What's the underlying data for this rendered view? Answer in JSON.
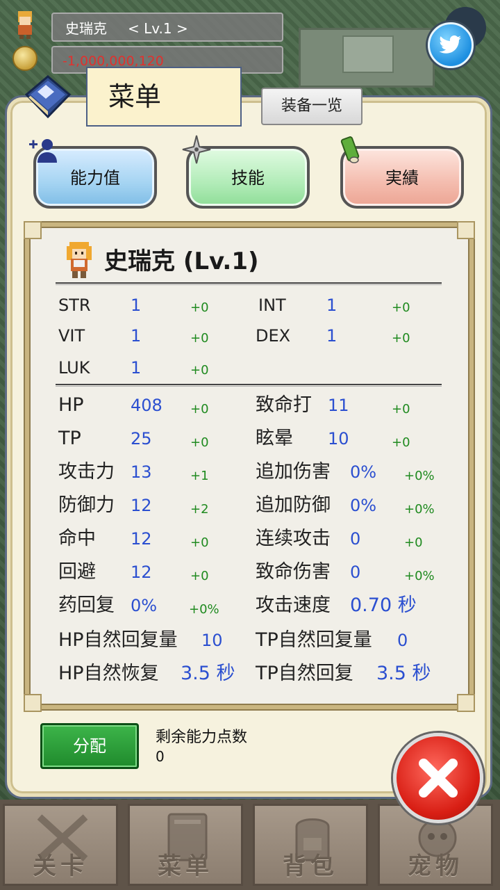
{
  "hud": {
    "name": "史瑞克",
    "level": "< Lv.1 >",
    "money": "-1,000,000,120"
  },
  "menu": {
    "title": "菜单",
    "equip_button": "装备一览",
    "tabs": [
      "能力值",
      "技能",
      "実績"
    ]
  },
  "character": {
    "title": "史瑞克 (Lv.1)"
  },
  "base_stats": [
    {
      "label": "STR",
      "value": "1",
      "bonus": "+0"
    },
    {
      "label": "INT",
      "value": "1",
      "bonus": "+0"
    },
    {
      "label": "VIT",
      "value": "1",
      "bonus": "+0"
    },
    {
      "label": "DEX",
      "value": "1",
      "bonus": "+0"
    },
    {
      "label": "LUK",
      "value": "1",
      "bonus": "+0"
    }
  ],
  "combat_stats_left": [
    {
      "label": "HP",
      "value": "408",
      "bonus": "+0"
    },
    {
      "label": "TP",
      "value": "25",
      "bonus": "+0"
    },
    {
      "label": "攻击力",
      "value": "13",
      "bonus": "+1"
    },
    {
      "label": "防御力",
      "value": "12",
      "bonus": "+2"
    },
    {
      "label": "命中",
      "value": "12",
      "bonus": "+0"
    },
    {
      "label": "回避",
      "value": "12",
      "bonus": "+0"
    },
    {
      "label": "药回复",
      "value": "0%",
      "bonus": "+0%"
    }
  ],
  "combat_stats_right": [
    {
      "label": "致命打",
      "value": "11",
      "bonus": "+0"
    },
    {
      "label": "眩晕",
      "value": "10",
      "bonus": "+0"
    },
    {
      "label": "追加伤害",
      "value": "0%",
      "bonus": "+0%"
    },
    {
      "label": "追加防御",
      "value": "0%",
      "bonus": "+0%"
    },
    {
      "label": "连续攻击",
      "value": "0",
      "bonus": "+0"
    },
    {
      "label": "致命伤害",
      "value": "0",
      "bonus": "+0%"
    },
    {
      "label": "攻击速度",
      "value": "0.70 秒",
      "bonus": ""
    }
  ],
  "regen": [
    {
      "label": "HP自然回复量",
      "value": "10"
    },
    {
      "label": "TP自然回复量",
      "value": "0"
    },
    {
      "label": "HP自然恢复",
      "value": "3.5 秒"
    },
    {
      "label": "TP自然回复",
      "value": "3.5 秒"
    }
  ],
  "points": {
    "assign_button": "分配",
    "remaining_label": "剩余能力点数",
    "remaining_value": "0"
  },
  "nav": [
    "关卡",
    "菜单",
    "背包",
    "宠物"
  ],
  "colors": {
    "value_blue": "#2b4fd0",
    "bonus_green": "#1f8a1f",
    "money_red": "#e0312e"
  }
}
